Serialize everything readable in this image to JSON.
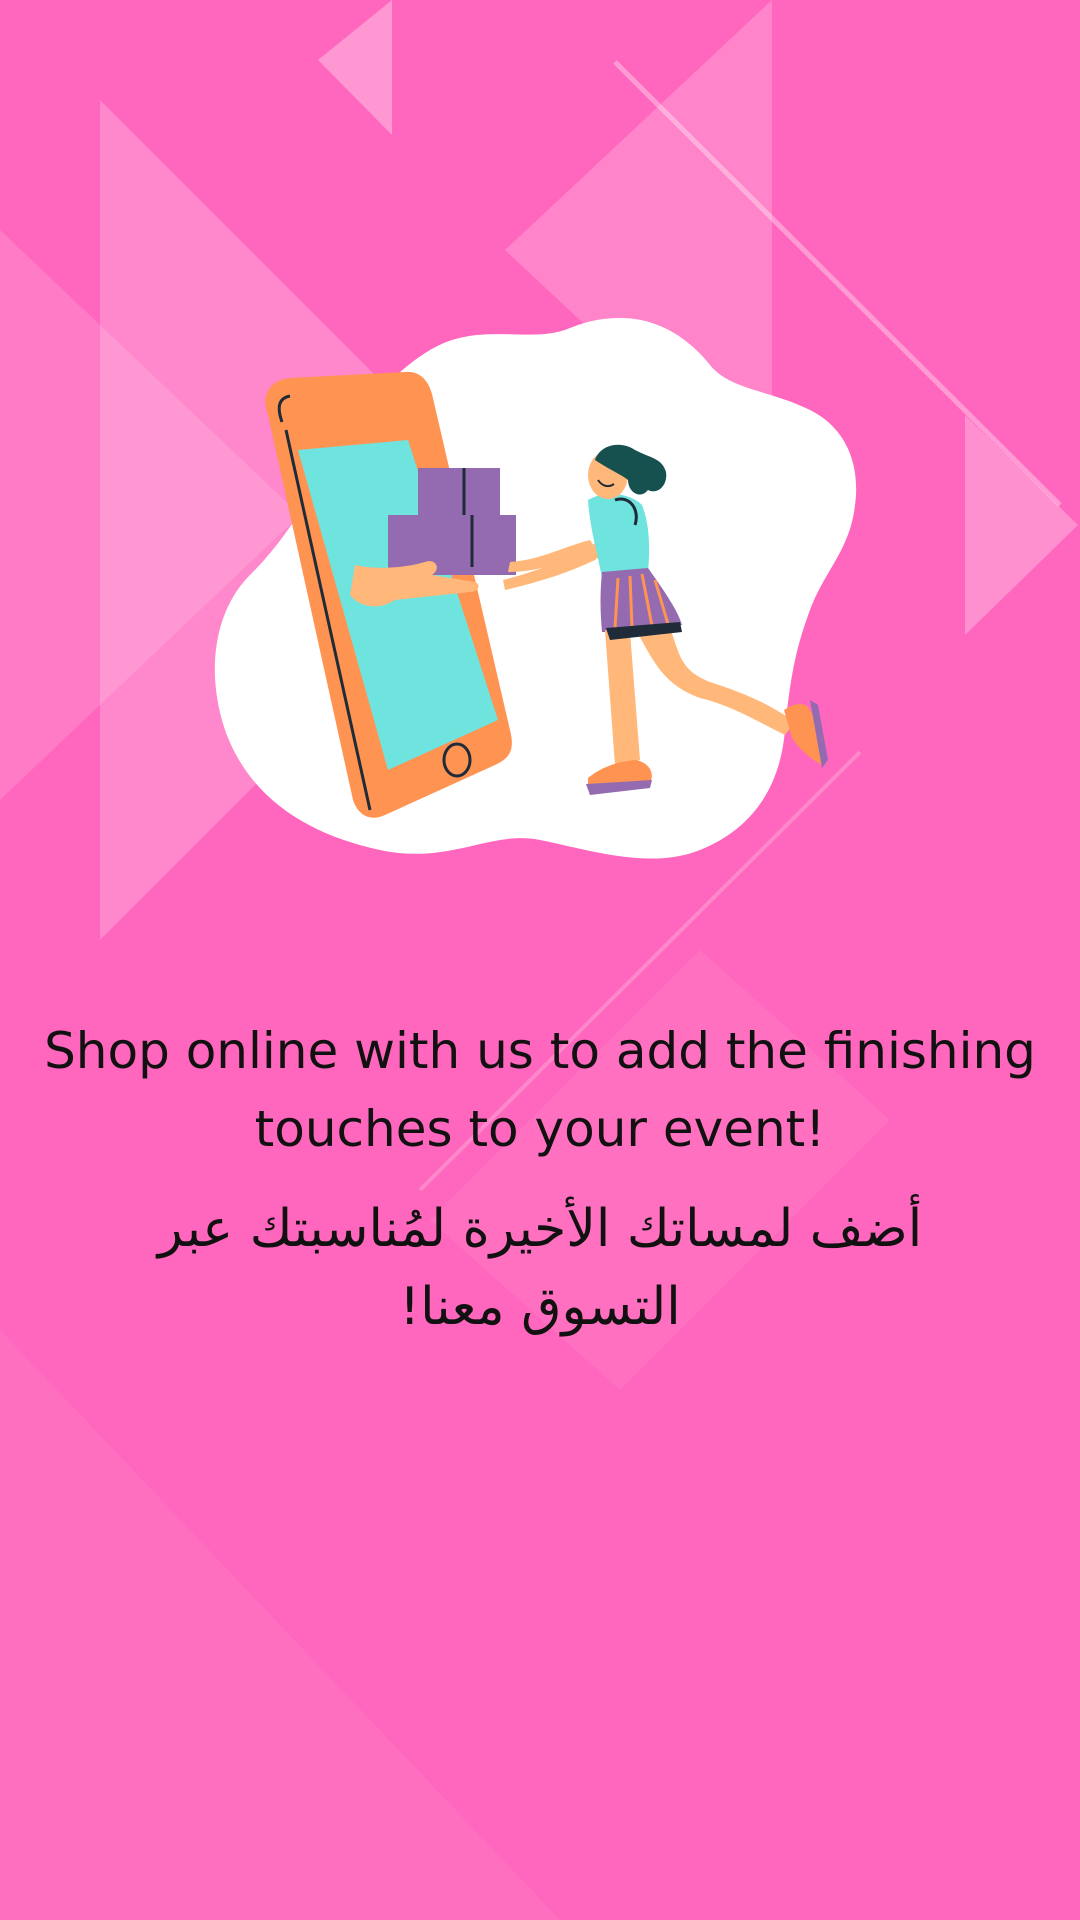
{
  "splash": {
    "headline_en": "Shop online with us to add the finishing touches to your event!",
    "headline_ar": "أضف لمساتك الأخيرة لمُناسبتك عبر التسوق معنا!"
  },
  "illustration": {
    "icon": "online-shopping-delivery-illustration"
  },
  "colors": {
    "background": "#ff66bd",
    "blob": "#ffffff",
    "phone_body": "#ff9452",
    "phone_screen": "#6fe3dd",
    "boxes": "#946bb0",
    "text": "#111111"
  }
}
